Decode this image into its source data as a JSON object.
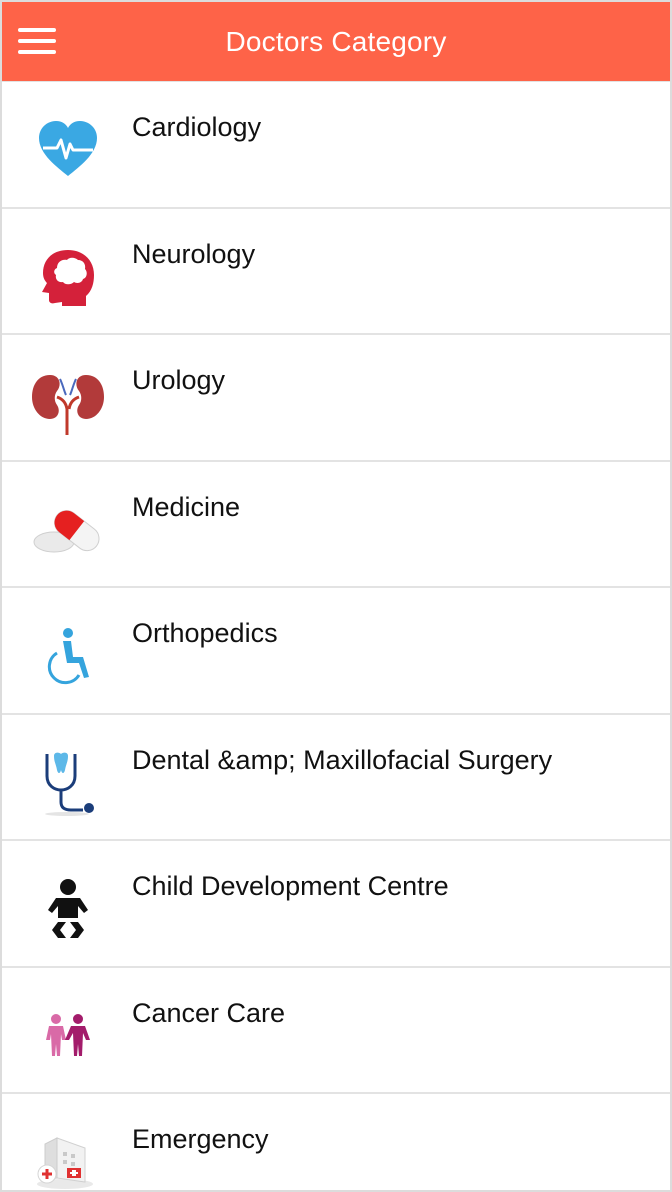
{
  "header": {
    "title": "Doctors Category",
    "background": "#fe6348",
    "menu_icon": "hamburger-menu-icon"
  },
  "categories": [
    {
      "label": "Cardiology",
      "icon": "heart-rate-icon",
      "color": "#3aa8e3"
    },
    {
      "label": "Neurology",
      "icon": "brain-head-icon",
      "color": "#d4213a"
    },
    {
      "label": "Urology",
      "icon": "kidneys-icon",
      "color": "#b23a3a"
    },
    {
      "label": "Medicine",
      "icon": "pill-capsule-icon",
      "color": "#e52020"
    },
    {
      "label": "Orthopedics",
      "icon": "wheelchair-icon",
      "color": "#35a4dd"
    },
    {
      "label": "Dental &amp; Maxillofacial Surgery",
      "icon": "tooth-stethoscope-icon",
      "color": "#1b3d7a"
    },
    {
      "label": "Child Development Centre",
      "icon": "baby-icon",
      "color": "#111111"
    },
    {
      "label": "Cancer Care",
      "icon": "two-people-icon",
      "color": "#c2488f"
    },
    {
      "label": "Emergency",
      "icon": "hospital-building-icon",
      "color": "#e03131"
    }
  ]
}
